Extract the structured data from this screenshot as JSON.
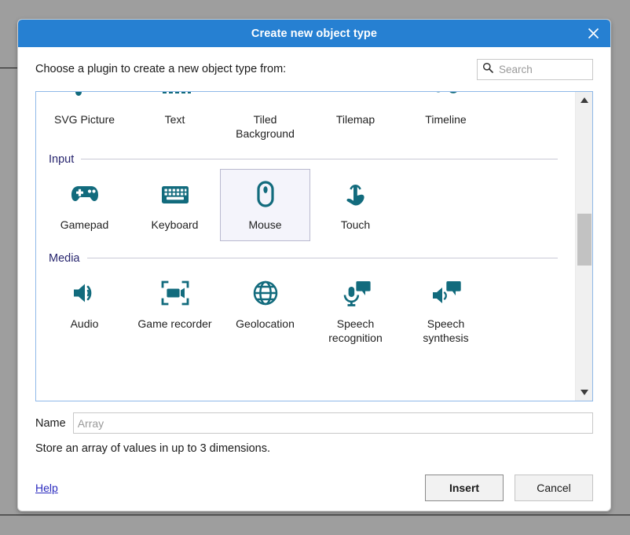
{
  "window": {
    "title": "Create new object type",
    "close_icon": "close-icon"
  },
  "header": {
    "instruction": "Choose a plugin to create a new object type from:",
    "search": {
      "placeholder": "Search",
      "value": "",
      "icon": "search-icon"
    }
  },
  "plugin_panel": {
    "rows": [
      {
        "section": null,
        "clipped": true,
        "items": [
          {
            "label": "SVG Picture",
            "icon": "svg-picture-icon",
            "selected": false
          },
          {
            "label": "Text",
            "icon": "text-icon",
            "selected": false
          },
          {
            "label": "Tiled Background",
            "icon": "tiled-background-icon",
            "selected": false
          },
          {
            "label": "Tilemap",
            "icon": "tilemap-icon",
            "selected": false
          },
          {
            "label": "Timeline",
            "icon": "timeline-icon",
            "selected": false
          }
        ]
      },
      {
        "section": "Input",
        "clipped": false,
        "items": [
          {
            "label": "Gamepad",
            "icon": "gamepad-icon",
            "selected": false
          },
          {
            "label": "Keyboard",
            "icon": "keyboard-icon",
            "selected": false
          },
          {
            "label": "Mouse",
            "icon": "mouse-icon",
            "selected": true
          },
          {
            "label": "Touch",
            "icon": "touch-icon",
            "selected": false
          }
        ]
      },
      {
        "section": "Media",
        "clipped": false,
        "items": [
          {
            "label": "Audio",
            "icon": "audio-icon",
            "selected": false
          },
          {
            "label": "Game recorder",
            "icon": "game-recorder-icon",
            "selected": false
          },
          {
            "label": "Geolocation",
            "icon": "geolocation-icon",
            "selected": false
          },
          {
            "label": "Speech recognition",
            "icon": "speech-recognition-icon",
            "selected": false
          },
          {
            "label": "Speech synthesis",
            "icon": "speech-synthesis-icon",
            "selected": false
          }
        ]
      }
    ],
    "scrollbar": {
      "up_icon": "scroll-up-arrow-icon",
      "down_icon": "scroll-down-arrow-icon"
    }
  },
  "name_field": {
    "label": "Name",
    "placeholder": "Array",
    "value": ""
  },
  "description": "Store an array of values in up to 3 dimensions.",
  "footer": {
    "help_label": "Help",
    "insert_label": "Insert",
    "cancel_label": "Cancel"
  },
  "colors": {
    "titlebar": "#2680d2",
    "icon_teal": "#126b7d",
    "section_heading": "#27256e",
    "link": "#2b2bbf",
    "panel_border": "#8fb8e8",
    "selected_tile_bg": "#f4f4fb"
  }
}
